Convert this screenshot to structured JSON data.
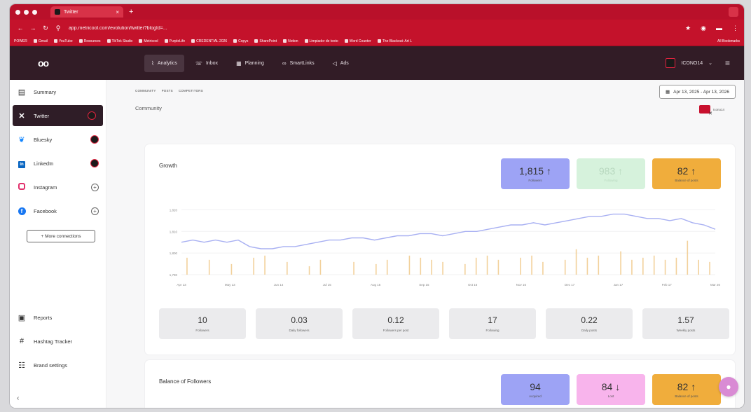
{
  "browser": {
    "tab_title": "Twitter",
    "url": "app.metricool.com/evolution/twitter?blogId=...",
    "bookmarks": [
      "POWER",
      "Gmail",
      "YouTube",
      "Resources",
      "TikTok Studio",
      "Metricool",
      "PurpleLife",
      "CREDENTIAL 2026",
      "Copys",
      "SharePoint",
      "Notion",
      "Limpiador de texto",
      "Word Counter",
      "The Blackout: Art L"
    ],
    "bookmarks_right": "All Bookmarks"
  },
  "header": {
    "logo": "oo",
    "nav": [
      {
        "label": "Analytics",
        "icon": "chart-line"
      },
      {
        "label": "Inbox",
        "icon": "chat"
      },
      {
        "label": "Planning",
        "icon": "calendar"
      },
      {
        "label": "SmartLinks",
        "icon": "link"
      },
      {
        "label": "Ads",
        "icon": "megaphone"
      }
    ],
    "account": "ICONO14"
  },
  "sidebar": {
    "items": [
      {
        "label": "Summary",
        "icon": "clipboard"
      },
      {
        "label": "Twitter",
        "icon": "x"
      },
      {
        "label": "Bluesky",
        "icon": "butterfly"
      },
      {
        "label": "LinkedIn",
        "icon": "linkedin"
      },
      {
        "label": "Instagram",
        "icon": "instagram"
      },
      {
        "label": "Facebook",
        "icon": "facebook"
      }
    ],
    "more_connections": "+ More connections",
    "bottom": [
      {
        "label": "Reports",
        "icon": "report"
      },
      {
        "label": "Hashtag Tracker",
        "icon": "hashtag"
      },
      {
        "label": "Brand settings",
        "icon": "settings"
      }
    ]
  },
  "main": {
    "subtabs": [
      "COMMUNITY",
      "POSTS",
      "COMPETITORS"
    ],
    "date_range": "Apr 13, 2025 - Apr 13, 2026",
    "section_title": "Community",
    "section_account": "Icono14"
  },
  "growth": {
    "title": "Growth",
    "kpis": [
      {
        "value": "1,815 ↑",
        "label": "Followers"
      },
      {
        "value": "983 ↑",
        "label": "Following"
      },
      {
        "value": "82 ↑",
        "label": "Balance of posts"
      }
    ],
    "stats": [
      {
        "value": "10",
        "label": "Followers"
      },
      {
        "value": "0.03",
        "label": "Daily followers"
      },
      {
        "value": "0.12",
        "label": "Followers per post"
      },
      {
        "value": "17",
        "label": "Following"
      },
      {
        "value": "0.22",
        "label": "Daily posts"
      },
      {
        "value": "1.57",
        "label": "Weekly posts"
      }
    ]
  },
  "balance": {
    "title": "Balance of Followers",
    "kpis": [
      {
        "value": "94",
        "label": "Acquired"
      },
      {
        "value": "84 ↓",
        "label": "Lost"
      },
      {
        "value": "82 ↑",
        "label": "Balance of posts"
      }
    ]
  },
  "chart_data": {
    "type": "line",
    "y_ticks": [
      "1,820",
      "1,810",
      "1,800",
      "1,790"
    ],
    "ylim": [
      1790,
      1825
    ],
    "x_ticks": [
      "Apr 13",
      "May 13",
      "Jun 14",
      "Jul 15",
      "Aug 15",
      "Sep 15",
      "Oct 16",
      "Nov 16",
      "Dec 17",
      "Jan 17",
      "Feb 17",
      "Mar 20"
    ],
    "series": [
      {
        "values": [
          1805,
          1806,
          1805,
          1806,
          1805,
          1806,
          1803,
          1802,
          1802,
          1803,
          1803,
          1804,
          1805,
          1806,
          1806,
          1807,
          1807,
          1806,
          1807,
          1808,
          1808,
          1809,
          1809,
          1808,
          1809,
          1810,
          1810,
          1811,
          1812,
          1813,
          1813,
          1814,
          1813,
          1814,
          1815,
          1816,
          1817,
          1817,
          1818,
          1818,
          1817,
          1816,
          1816,
          1815,
          1816,
          1814,
          1813,
          1811
        ]
      }
    ],
    "posts_bars": [
      0.8,
      0,
      0.7,
      0,
      0.5,
      0,
      0.8,
      0.9,
      0,
      0.6,
      0,
      0.4,
      0.7,
      0,
      0,
      0.6,
      0,
      0.5,
      0.7,
      0,
      0.9,
      0.8,
      0.7,
      0.6,
      0,
      0.5,
      0.8,
      0.9,
      0.7,
      0,
      0.8,
      0.9,
      0.6,
      0,
      0.7,
      1.2,
      0.8,
      0.9,
      0,
      1.1,
      0.7,
      0.8,
      0.9,
      0.7,
      0.8,
      1.6,
      0.7,
      0.6
    ],
    "grid": true
  },
  "colors": {
    "brand_dark": "#321c26",
    "browser_red": "#c4122b",
    "line": "#a8b0f2",
    "bars": "#f0c98a"
  }
}
